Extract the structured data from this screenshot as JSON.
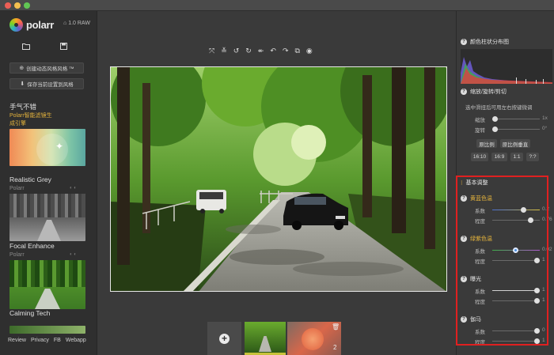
{
  "app": {
    "name": "polarr",
    "version": "1.0 RAW"
  },
  "left_panel": {
    "open_icon": "folder-open-icon",
    "save_icon": "save-icon",
    "create_style_label": "创建动态风格风格 ™",
    "save_style_label": "保存当前设置到风格",
    "featured": {
      "title": "手气不错",
      "subtitle": "Polarr智能滤镜生",
      "subtitle2": "成引擎"
    },
    "filters": [
      {
        "name": "Realistic Grey",
        "author": "Polarr"
      },
      {
        "name": "Focal Enhance",
        "author": "Polarr"
      },
      {
        "name": "Calming Tech",
        "author": ""
      }
    ],
    "footer_links": [
      "Review",
      "Privacy",
      "FB",
      "Webapp"
    ]
  },
  "toolbar": {
    "icons": [
      "fullscreen-icon",
      "compare-icon",
      "rotate-left-icon",
      "rotate-right-icon",
      "undo-all-icon",
      "undo-icon",
      "redo-icon",
      "copy-icon",
      "preview-icon"
    ],
    "glyphs": [
      "⤧",
      "≚",
      "↺",
      "↻",
      "↞",
      "↶",
      "↷",
      "⧉",
      "◉"
    ]
  },
  "filmstrip": {
    "add_icon": "+",
    "count": "2"
  },
  "right_panel": {
    "histogram_title": "颜色柱状分布图",
    "crop": {
      "title": "缩放/旋转/剪切",
      "hint": "选中滑扭后可用左右按键微调",
      "zoom_label": "缩放",
      "zoom_value": "1x",
      "rotate_label": "旋转",
      "rotate_value": "0°",
      "ratio_original": "原比例",
      "ratio_vertical": "原比例垂直",
      "ratios": [
        "16:10",
        "16:9",
        "1:1",
        "?:?"
      ]
    },
    "basic": {
      "title": "基本调整",
      "groups": [
        {
          "title": "黄蓝色温",
          "rows": [
            {
              "label": "系数",
              "value": "0.2"
            },
            {
              "label": "程度",
              "value": "0.76"
            }
          ]
        },
        {
          "title": "绿紫色温",
          "rows": [
            {
              "label": "系数",
              "value": "0.02"
            },
            {
              "label": "程度",
              "value": "1"
            }
          ]
        },
        {
          "title": "曝光",
          "rows": [
            {
              "label": "系数",
              "value": "1"
            },
            {
              "label": "程度",
              "value": "1"
            }
          ]
        },
        {
          "title": "伽马",
          "rows": [
            {
              "label": "系数",
              "value": "0"
            },
            {
              "label": "程度",
              "value": "1"
            }
          ]
        }
      ]
    }
  },
  "colors": {
    "highlight": "#e02020",
    "accent_yellow": "#e3b23c",
    "accent_blue": "#4a8fe0"
  }
}
